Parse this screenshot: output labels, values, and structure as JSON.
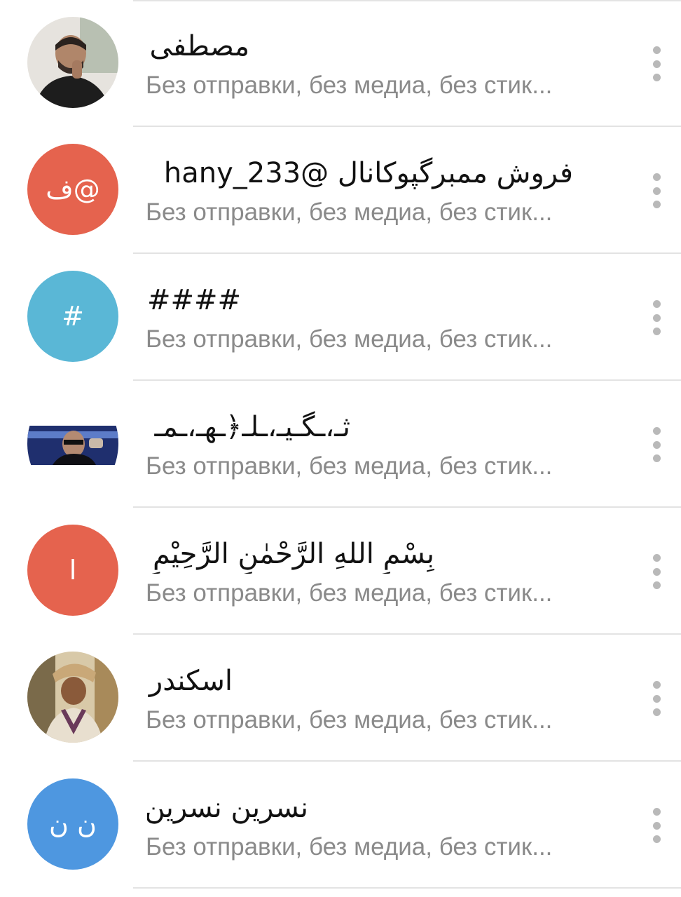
{
  "chats": [
    {
      "title": "مصطفى",
      "subtitle": "Без отправки, без медиа, без стик...",
      "avatar": {
        "type": "photo",
        "icon": "person-photo-avatar",
        "colors": [
          "#2b2b2b",
          "#7c6a5a",
          "#d9d2c6"
        ]
      }
    },
    {
      "title": "فروش ممبرگپوکانال @hany_233",
      "subtitle": "Без отправки, без медиа, без стик...",
      "avatar": {
        "type": "initials",
        "initials": "ف@",
        "color": "#e5634e"
      }
    },
    {
      "title": "####",
      "subtitle": "Без отправки, без медиа, без стик...",
      "avatar": {
        "type": "initials",
        "initials": "#",
        "color": "#5ab7d6"
      }
    },
    {
      "title": "ثـ،ـگـيـ،ـلـ﴿ـهـ،ـمـ",
      "subtitle": "Без отправки, без медиа, без стик...",
      "avatar": {
        "type": "photo",
        "icon": "person-car-photo-avatar",
        "colors": [
          "#1d2a66",
          "#3d5aa8",
          "#c9b9a9"
        ]
      }
    },
    {
      "title": "بِسْمِ اللهِ الرَّحْمٰنِ الرَّحِيْمِ",
      "subtitle": "Без отправки, без медиа, без стик...",
      "avatar": {
        "type": "initials",
        "initials": "ا",
        "color": "#e5634e"
      }
    },
    {
      "title": "اسکندر",
      "subtitle": "Без отправки, без медиа, без стик...",
      "avatar": {
        "type": "photo",
        "icon": "person-outdoor-photo-avatar",
        "colors": [
          "#8a6a3a",
          "#c9a060",
          "#4a3a2a"
        ]
      }
    },
    {
      "title": "نسرین نسرین",
      "subtitle": "Без отправки, без медиа, без стик...",
      "avatar": {
        "type": "initials",
        "initials": "ن ن",
        "color": "#4e97e0"
      }
    }
  ]
}
